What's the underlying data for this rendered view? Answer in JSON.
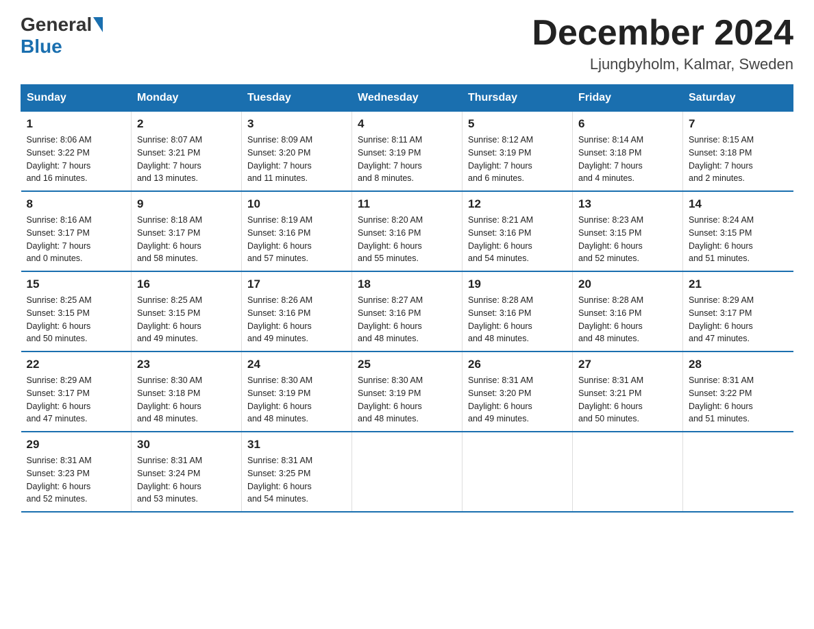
{
  "header": {
    "logo_general": "General",
    "logo_blue": "Blue",
    "month_title": "December 2024",
    "location": "Ljungbyholm, Kalmar, Sweden"
  },
  "weekdays": [
    "Sunday",
    "Monday",
    "Tuesday",
    "Wednesday",
    "Thursday",
    "Friday",
    "Saturday"
  ],
  "weeks": [
    [
      {
        "day": "1",
        "sunrise": "8:06 AM",
        "sunset": "3:22 PM",
        "daylight": "7 hours and 16 minutes."
      },
      {
        "day": "2",
        "sunrise": "8:07 AM",
        "sunset": "3:21 PM",
        "daylight": "7 hours and 13 minutes."
      },
      {
        "day": "3",
        "sunrise": "8:09 AM",
        "sunset": "3:20 PM",
        "daylight": "7 hours and 11 minutes."
      },
      {
        "day": "4",
        "sunrise": "8:11 AM",
        "sunset": "3:19 PM",
        "daylight": "7 hours and 8 minutes."
      },
      {
        "day": "5",
        "sunrise": "8:12 AM",
        "sunset": "3:19 PM",
        "daylight": "7 hours and 6 minutes."
      },
      {
        "day": "6",
        "sunrise": "8:14 AM",
        "sunset": "3:18 PM",
        "daylight": "7 hours and 4 minutes."
      },
      {
        "day": "7",
        "sunrise": "8:15 AM",
        "sunset": "3:18 PM",
        "daylight": "7 hours and 2 minutes."
      }
    ],
    [
      {
        "day": "8",
        "sunrise": "8:16 AM",
        "sunset": "3:17 PM",
        "daylight": "7 hours and 0 minutes."
      },
      {
        "day": "9",
        "sunrise": "8:18 AM",
        "sunset": "3:17 PM",
        "daylight": "6 hours and 58 minutes."
      },
      {
        "day": "10",
        "sunrise": "8:19 AM",
        "sunset": "3:16 PM",
        "daylight": "6 hours and 57 minutes."
      },
      {
        "day": "11",
        "sunrise": "8:20 AM",
        "sunset": "3:16 PM",
        "daylight": "6 hours and 55 minutes."
      },
      {
        "day": "12",
        "sunrise": "8:21 AM",
        "sunset": "3:16 PM",
        "daylight": "6 hours and 54 minutes."
      },
      {
        "day": "13",
        "sunrise": "8:23 AM",
        "sunset": "3:15 PM",
        "daylight": "6 hours and 52 minutes."
      },
      {
        "day": "14",
        "sunrise": "8:24 AM",
        "sunset": "3:15 PM",
        "daylight": "6 hours and 51 minutes."
      }
    ],
    [
      {
        "day": "15",
        "sunrise": "8:25 AM",
        "sunset": "3:15 PM",
        "daylight": "6 hours and 50 minutes."
      },
      {
        "day": "16",
        "sunrise": "8:25 AM",
        "sunset": "3:15 PM",
        "daylight": "6 hours and 49 minutes."
      },
      {
        "day": "17",
        "sunrise": "8:26 AM",
        "sunset": "3:16 PM",
        "daylight": "6 hours and 49 minutes."
      },
      {
        "day": "18",
        "sunrise": "8:27 AM",
        "sunset": "3:16 PM",
        "daylight": "6 hours and 48 minutes."
      },
      {
        "day": "19",
        "sunrise": "8:28 AM",
        "sunset": "3:16 PM",
        "daylight": "6 hours and 48 minutes."
      },
      {
        "day": "20",
        "sunrise": "8:28 AM",
        "sunset": "3:16 PM",
        "daylight": "6 hours and 48 minutes."
      },
      {
        "day": "21",
        "sunrise": "8:29 AM",
        "sunset": "3:17 PM",
        "daylight": "6 hours and 47 minutes."
      }
    ],
    [
      {
        "day": "22",
        "sunrise": "8:29 AM",
        "sunset": "3:17 PM",
        "daylight": "6 hours and 47 minutes."
      },
      {
        "day": "23",
        "sunrise": "8:30 AM",
        "sunset": "3:18 PM",
        "daylight": "6 hours and 48 minutes."
      },
      {
        "day": "24",
        "sunrise": "8:30 AM",
        "sunset": "3:19 PM",
        "daylight": "6 hours and 48 minutes."
      },
      {
        "day": "25",
        "sunrise": "8:30 AM",
        "sunset": "3:19 PM",
        "daylight": "6 hours and 48 minutes."
      },
      {
        "day": "26",
        "sunrise": "8:31 AM",
        "sunset": "3:20 PM",
        "daylight": "6 hours and 49 minutes."
      },
      {
        "day": "27",
        "sunrise": "8:31 AM",
        "sunset": "3:21 PM",
        "daylight": "6 hours and 50 minutes."
      },
      {
        "day": "28",
        "sunrise": "8:31 AM",
        "sunset": "3:22 PM",
        "daylight": "6 hours and 51 minutes."
      }
    ],
    [
      {
        "day": "29",
        "sunrise": "8:31 AM",
        "sunset": "3:23 PM",
        "daylight": "6 hours and 52 minutes."
      },
      {
        "day": "30",
        "sunrise": "8:31 AM",
        "sunset": "3:24 PM",
        "daylight": "6 hours and 53 minutes."
      },
      {
        "day": "31",
        "sunrise": "8:31 AM",
        "sunset": "3:25 PM",
        "daylight": "6 hours and 54 minutes."
      },
      null,
      null,
      null,
      null
    ]
  ]
}
